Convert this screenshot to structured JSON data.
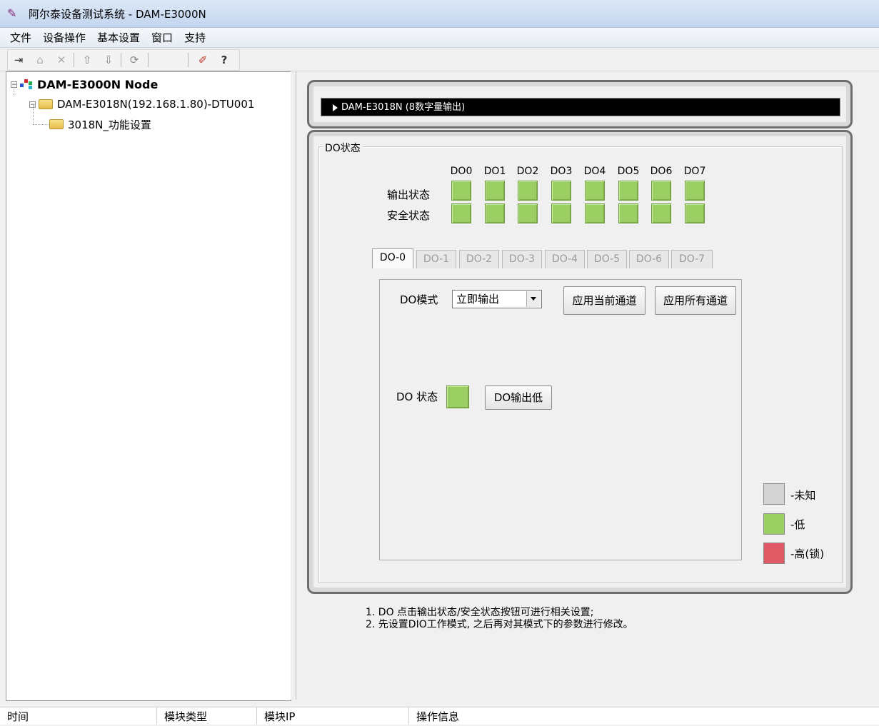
{
  "window": {
    "title": "阿尔泰设备测试系统 - DAM-E3000N"
  },
  "menu": [
    "文件",
    "设备操作",
    "基本设置",
    "窗口",
    "支持"
  ],
  "toolbar": {
    "icons": [
      "connect-icon",
      "device-icon",
      "disconnect-icon",
      "upload-icon",
      "download-icon",
      "refresh-icon",
      "config-icon",
      "help-icon"
    ]
  },
  "tree": {
    "root": "DAM-E3000N Node",
    "device": "DAM-E3018N(192.168.1.80)-DTU001",
    "function": "3018N_功能设置"
  },
  "header": {
    "title": "DAM-E3018N (8数字量输出)"
  },
  "do_status": {
    "caption": "DO状态",
    "channels": [
      "DO0",
      "DO1",
      "DO2",
      "DO3",
      "DO4",
      "DO5",
      "DO6",
      "DO7"
    ],
    "output_label": "输出状态",
    "safe_label": "安全状态",
    "output_states": [
      "低",
      "低",
      "低",
      "低",
      "低",
      "低",
      "低",
      "低"
    ],
    "safe_states": [
      "低",
      "低",
      "低",
      "低",
      "低",
      "低",
      "低",
      "低"
    ]
  },
  "tabs": [
    "DO-0",
    "DO-1",
    "DO-2",
    "DO-3",
    "DO-4",
    "DO-5",
    "DO-6",
    "DO-7"
  ],
  "active_tab": "DO-0",
  "channel_panel": {
    "mode_label": "DO模式",
    "mode_value": "立即输出",
    "apply_current": "应用当前通道",
    "apply_all": "应用所有通道",
    "state_label": "DO 状态",
    "state_value": "低",
    "output_low_button": "DO输出低"
  },
  "legend": [
    {
      "label": "-未知",
      "color": "#d4d4d4"
    },
    {
      "label": "-低",
      "color": "#9bce63"
    },
    {
      "label": "-高(锁)",
      "color": "#e05a66"
    }
  ],
  "notes": [
    "1. DO 点击输出状态/安全状态按钮可进行相关设置;",
    "2. 先设置DIO工作模式, 之后再对其模式下的参数进行修改。"
  ],
  "status_columns": [
    "时间",
    "模块类型",
    "模块IP",
    "操作信息"
  ],
  "colors": {
    "do_low": "#9bce63",
    "unknown": "#d4d4d4",
    "high_locked": "#e05a66",
    "header_bg": "#000000"
  }
}
